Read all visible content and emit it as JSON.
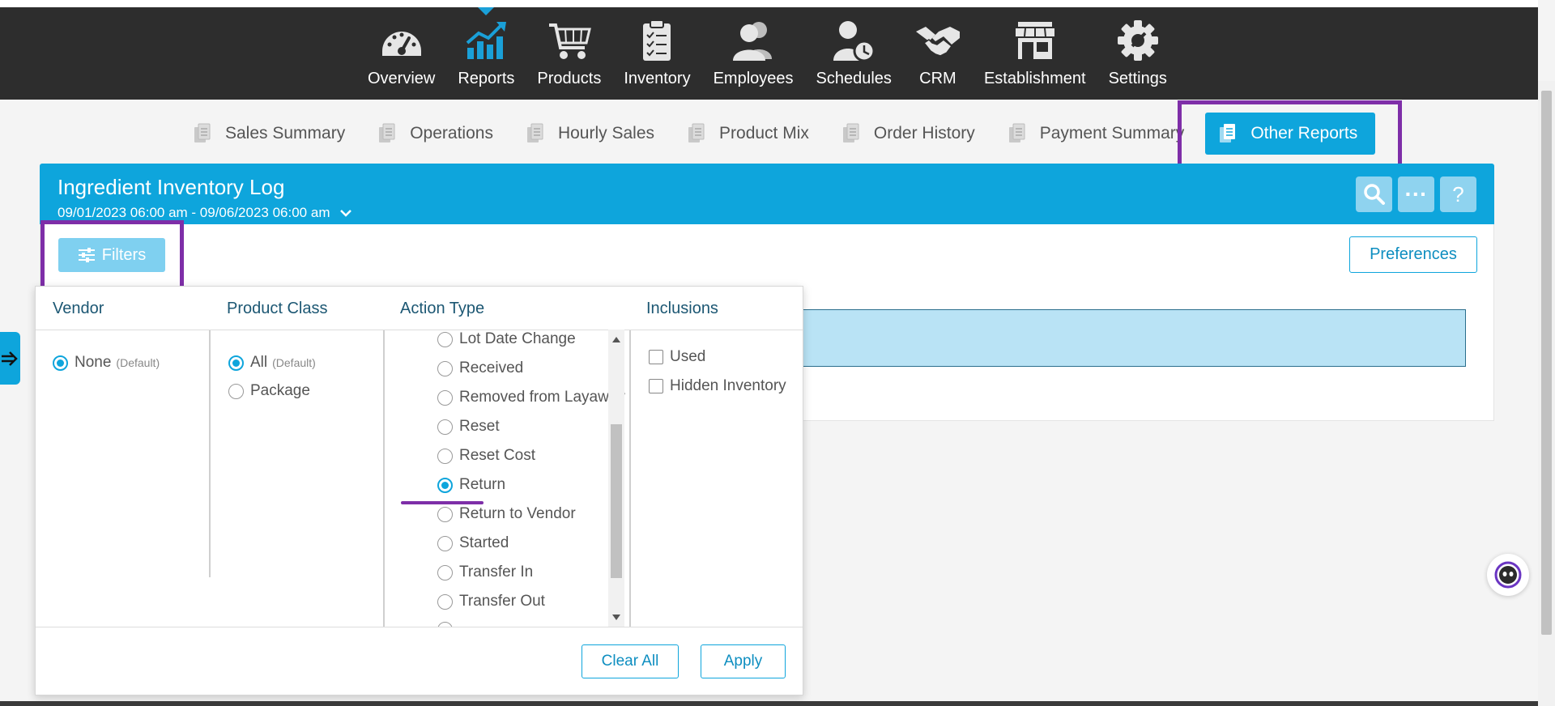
{
  "nav": {
    "items": [
      {
        "label": "Overview",
        "icon": "speedometer-icon"
      },
      {
        "label": "Reports",
        "icon": "chart-icon",
        "active": true
      },
      {
        "label": "Products",
        "icon": "cart-icon"
      },
      {
        "label": "Inventory",
        "icon": "clipboard-icon"
      },
      {
        "label": "Employees",
        "icon": "people-icon"
      },
      {
        "label": "Schedules",
        "icon": "person-clock-icon"
      },
      {
        "label": "CRM",
        "icon": "handshake-icon"
      },
      {
        "label": "Establishment",
        "icon": "storefront-icon"
      },
      {
        "label": "Settings",
        "icon": "gear-icon"
      }
    ]
  },
  "subtabs": {
    "items": [
      {
        "label": "Sales Summary"
      },
      {
        "label": "Operations"
      },
      {
        "label": "Hourly Sales"
      },
      {
        "label": "Product Mix"
      },
      {
        "label": "Order History"
      },
      {
        "label": "Payment Summary"
      },
      {
        "label": "Other Reports",
        "active": true
      }
    ]
  },
  "report": {
    "title": "Ingredient Inventory Log",
    "date_range": "09/01/2023 06:00 am - 09/06/2023 06:00 am",
    "filters_label": "Filters",
    "preferences_label": "Preferences",
    "more_label": "···",
    "help_label": "?"
  },
  "filters": {
    "vendor": {
      "heading": "Vendor",
      "options": [
        {
          "label": "None",
          "note": "(Default)",
          "selected": true
        }
      ]
    },
    "product_class": {
      "heading": "Product Class",
      "options": [
        {
          "label": "All",
          "note": "(Default)",
          "selected": true
        },
        {
          "label": "Package",
          "note": "",
          "selected": false
        }
      ]
    },
    "action_type": {
      "heading": "Action Type",
      "options": [
        {
          "label": "Lot Date Change",
          "selected": false
        },
        {
          "label": "Received",
          "selected": false
        },
        {
          "label": "Removed from Layaway",
          "selected": false
        },
        {
          "label": "Reset",
          "selected": false
        },
        {
          "label": "Reset Cost",
          "selected": false
        },
        {
          "label": "Return",
          "selected": true
        },
        {
          "label": "Return to Vendor",
          "selected": false
        },
        {
          "label": "Started",
          "selected": false
        },
        {
          "label": "Transfer In",
          "selected": false
        },
        {
          "label": "Transfer Out",
          "selected": false
        }
      ]
    },
    "inclusions": {
      "heading": "Inclusions",
      "options": [
        {
          "label": "Used",
          "checked": false
        },
        {
          "label": "Hidden Inventory",
          "checked": false
        }
      ]
    },
    "clear_all_label": "Clear All",
    "apply_label": "Apply"
  },
  "colors": {
    "accent": "#0ea5dc",
    "topbar": "#2d2d2d",
    "highlight": "#7e2ea8",
    "result_bar": "#b9e3f5"
  }
}
